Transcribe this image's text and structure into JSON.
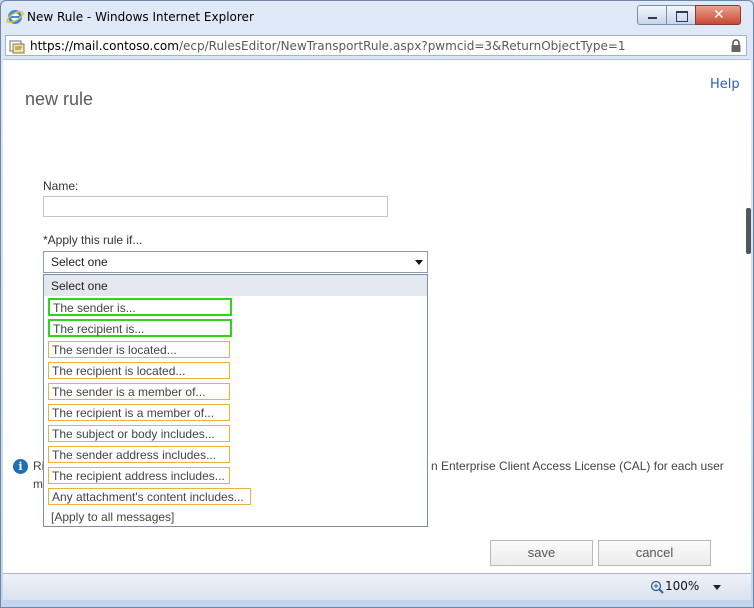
{
  "window": {
    "title": "New Rule - Windows Internet Explorer",
    "url_main": "https://mail.contoso.com",
    "url_rest": "/ecp/RulesEditor/NewTransportRule.aspx?pwmcid=3&ReturnObjectType=1"
  },
  "page": {
    "help_link": "Help",
    "title": "new rule",
    "name_label": "Name:",
    "name_value": "",
    "apply_label": "*Apply this rule if...",
    "select_value": "Select one"
  },
  "dropdown": {
    "header": "Select one",
    "items": [
      {
        "label": "The sender is...",
        "highlight": "green"
      },
      {
        "label": "The recipient is...",
        "highlight": "green"
      },
      {
        "label": "The sender is located...",
        "highlight": "orange"
      },
      {
        "label": "The recipient is located...",
        "highlight": "orange"
      },
      {
        "label": "The sender is a member of...",
        "highlight": "orange"
      },
      {
        "label": "The recipient is a member of...",
        "highlight": "orange"
      },
      {
        "label": "The subject or body includes...",
        "highlight": "orange"
      },
      {
        "label": "The sender address includes...",
        "highlight": "orange"
      },
      {
        "label": "The recipient address includes...",
        "highlight": "orange"
      },
      {
        "label": "Any attachment's content includes...",
        "highlight": "orange"
      },
      {
        "label": "[Apply to all messages]",
        "highlight": "none"
      }
    ]
  },
  "info": {
    "fragment_line1": "Ri",
    "fragment_line2": "m",
    "text": "n Enterprise Client Access License (CAL) for each user"
  },
  "buttons": {
    "save": "save",
    "cancel": "cancel"
  },
  "status": {
    "zoom": "100%"
  },
  "colors": {
    "highlight_green": "#2fd41f",
    "highlight_orange": "#f0b13c",
    "link": "#2a62b6"
  },
  "icons": [
    "ie-logo-icon",
    "minimize-icon",
    "maximize-icon",
    "close-icon",
    "page-icon",
    "lock-icon",
    "info-icon",
    "zoom-icon",
    "dropdown-arrow-icon"
  ]
}
